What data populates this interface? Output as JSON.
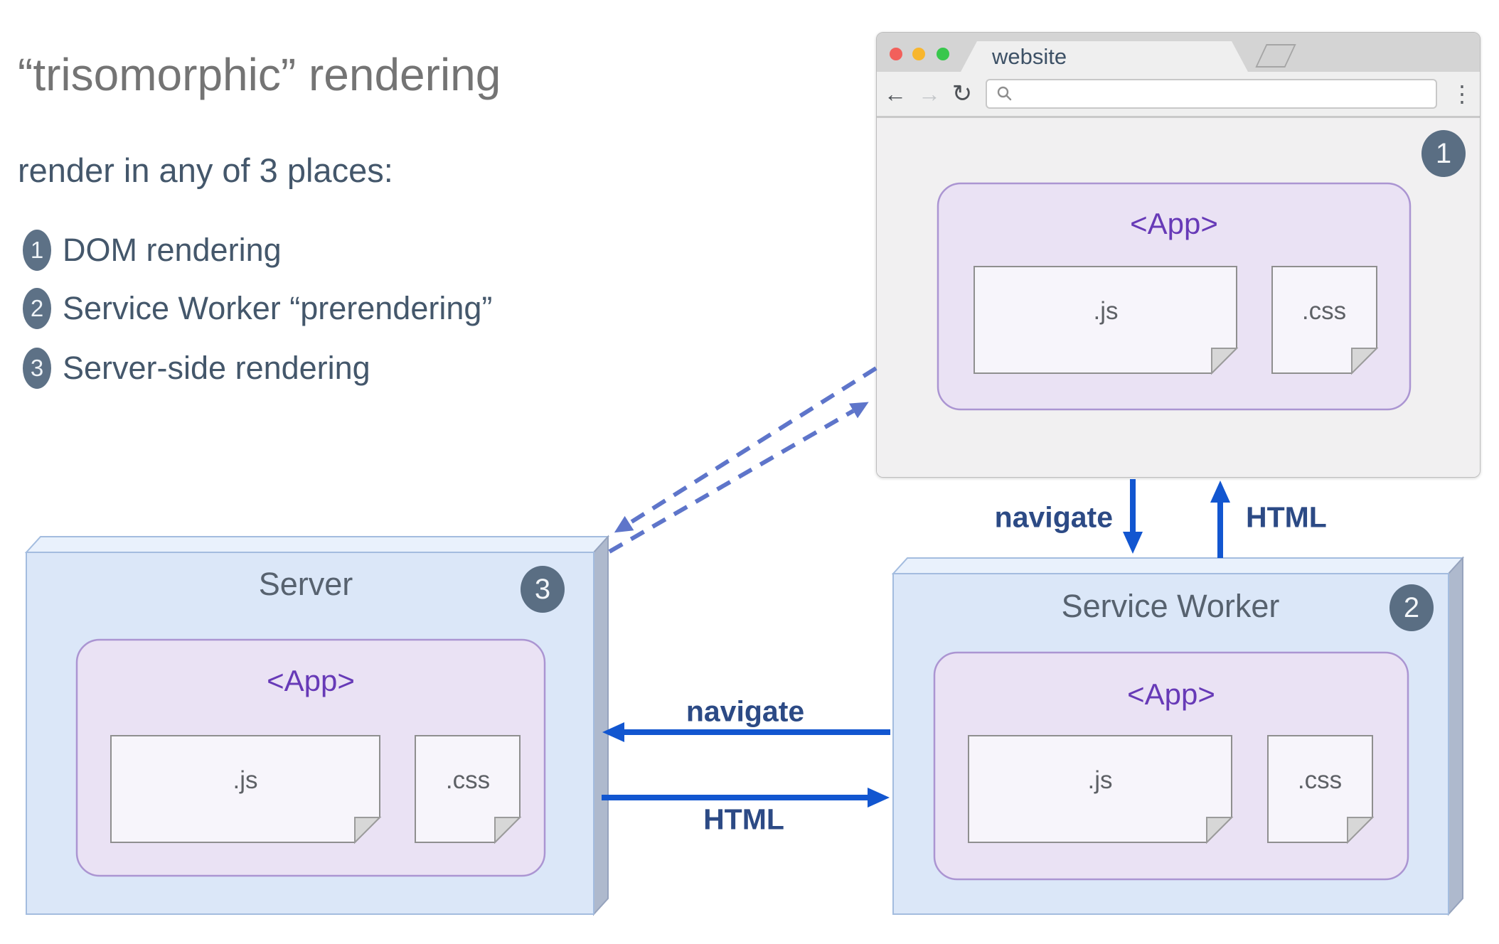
{
  "intro": {
    "title": "“trisomorphic” rendering",
    "subtitle": "render in any of 3 places:",
    "items": [
      {
        "num": "1",
        "label": "DOM rendering"
      },
      {
        "num": "2",
        "label": "Service Worker “prerendering”"
      },
      {
        "num": "3",
        "label": "Server-side rendering"
      }
    ]
  },
  "browser": {
    "tab_title": "website",
    "badge": "1",
    "toolbar": {
      "back_icon": "←",
      "forward_icon": "→",
      "reload_icon": "↻",
      "menu_icon": "⋮",
      "url_value": ""
    },
    "app": {
      "label": "<App>",
      "js_label": ".js",
      "css_label": ".css"
    }
  },
  "server": {
    "title": "Server",
    "badge": "3",
    "app": {
      "label": "<App>",
      "js_label": ".js",
      "css_label": ".css"
    }
  },
  "service_worker": {
    "title": "Service Worker",
    "badge": "2",
    "app": {
      "label": "<App>",
      "js_label": ".js",
      "css_label": ".css"
    }
  },
  "flows": {
    "browser_sw_request": "navigate",
    "browser_sw_response": "HTML",
    "sw_server_request": "navigate",
    "sw_server_response": "HTML"
  },
  "colors": {
    "arrow_blue": "#1256d0",
    "flow_label_navy": "#2c4a85",
    "dashed_arrow_blue": "#5e75ca",
    "badge_slate": "#5a6e83",
    "app_purple": "#673ab7",
    "box_front": "#dbe7f8",
    "box_top": "#e9f1fc",
    "box_side": "#aeb9cd",
    "app_fill": "#eae2f4",
    "traffic_red": "#f2605b",
    "traffic_yellow": "#f8b62d",
    "traffic_green": "#38c74c"
  }
}
